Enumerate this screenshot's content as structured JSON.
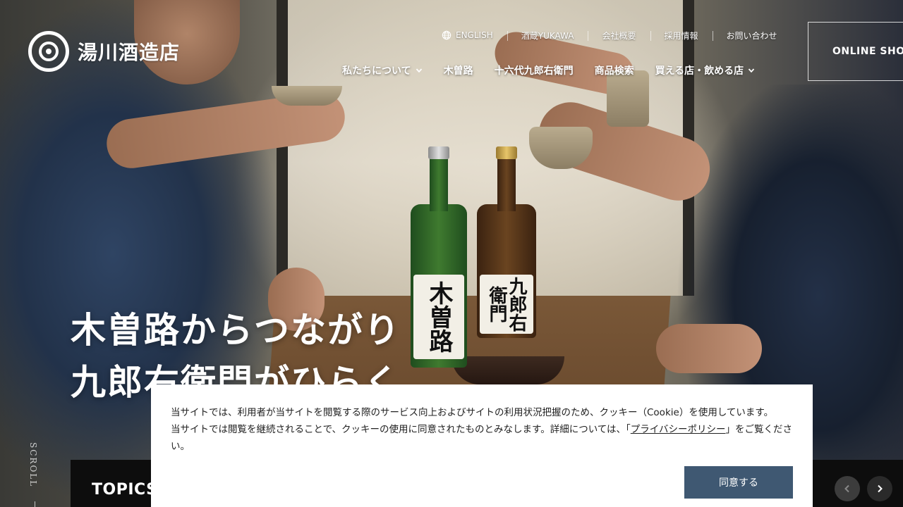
{
  "brand": {
    "name": "湯川酒造店"
  },
  "util_nav": {
    "english": "ENGLISH",
    "items": [
      "酒蔵YUKAWA",
      "会社概要",
      "採用情報",
      "お問い合わせ"
    ]
  },
  "main_nav": {
    "items": [
      {
        "label": "私たちについて",
        "has_dropdown": true
      },
      {
        "label": "木曽路",
        "has_dropdown": false
      },
      {
        "label": "十六代九郎右衛門",
        "has_dropdown": false
      },
      {
        "label": "商品検索",
        "has_dropdown": false
      },
      {
        "label": "買える店・飲める店",
        "has_dropdown": true
      }
    ]
  },
  "online_shop": {
    "label": "ONLINE SHOP"
  },
  "hero": {
    "line1": "木曽路からつながり",
    "line2": "九郎右衛門がひらく",
    "bottle_left_label": "木曽路",
    "bottle_right_label": "九郎右衛門"
  },
  "scroll": {
    "label": "SCROLL"
  },
  "topics": {
    "label": "TOPICS"
  },
  "cookie": {
    "line1": "当サイトでは、利用者が当サイトを閲覧する際のサービス向上およびサイトの利用状況把握のため、クッキー（Cookie）を使用しています。",
    "line2_before": "当サイトでは閲覧を継続されることで、クッキーの使用に同意されたものとみなします。詳細については、「",
    "link": "プライバシーポリシー",
    "line2_after": "」をご覧ください。",
    "agree_label": "同意する"
  },
  "colors": {
    "agree_button": "#3f5872",
    "topics_bar": "#0d0d0d"
  }
}
